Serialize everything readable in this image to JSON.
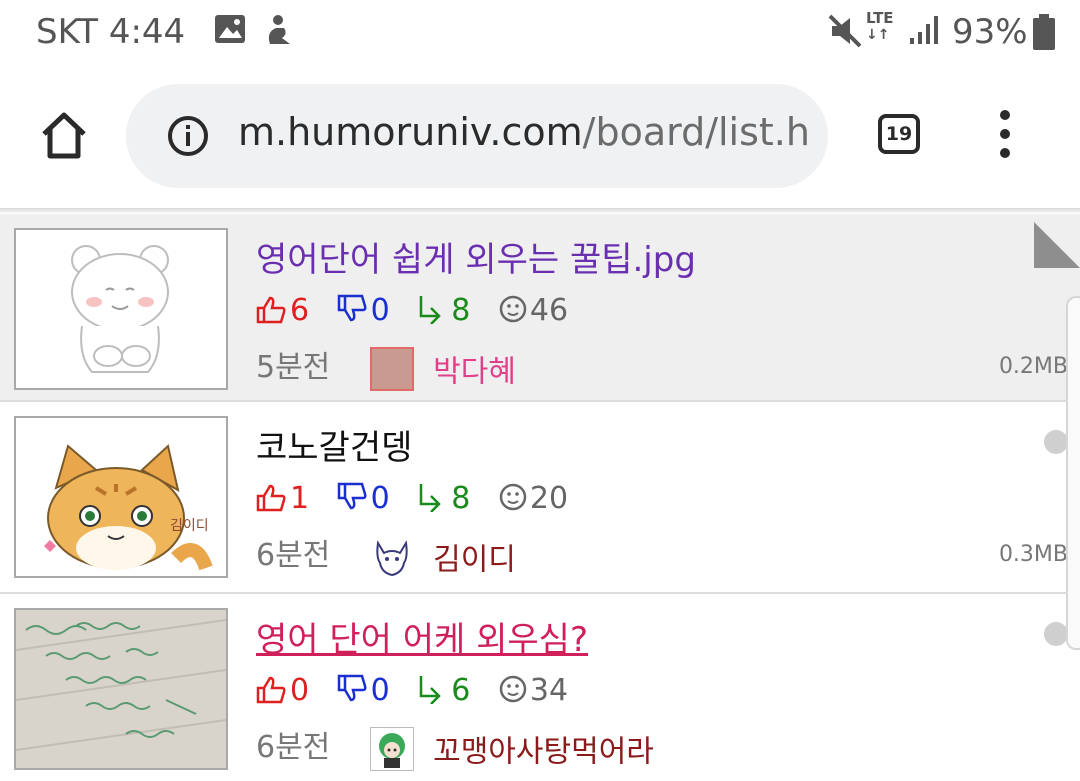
{
  "status_bar": {
    "carrier_time": "SKT 4:44",
    "network": "LTE",
    "battery": "93%",
    "icons": [
      "image-icon",
      "accessibility-icon",
      "mute-icon",
      "lte-icon",
      "signal-icon",
      "battery-icon"
    ]
  },
  "browser": {
    "url_domain": "m.humoruniv.com",
    "url_path": "/board/list.h",
    "tab_count": "19",
    "icons": [
      "home-icon",
      "info-icon",
      "tab-switcher-icon",
      "more-menu-icon"
    ]
  },
  "posts": [
    {
      "title": "영어단어 쉽게 외우는 꿀팁.jpg",
      "title_color": "#6a2fb0",
      "likes": "6",
      "dislikes": "0",
      "shares": "8",
      "comments": "46",
      "time": "5분전",
      "author": "박다혜",
      "author_color": "#e0408a",
      "size": "0.2MB"
    },
    {
      "title": "코노갈건뎅",
      "title_color": "#111111",
      "likes": "1",
      "dislikes": "0",
      "shares": "8",
      "comments": "20",
      "time": "6분전",
      "author": "김이디",
      "author_color": "#8b1a1a",
      "size": "0.3MB"
    },
    {
      "title": "영어 단어 어케 외우심?",
      "title_color": "#d0205a",
      "likes": "0",
      "dislikes": "0",
      "shares": "6",
      "comments": "34",
      "time": "6분전",
      "author": "꼬맹아사탕먹어라",
      "author_color": "#8b1a1a",
      "size": ""
    }
  ],
  "colors": {
    "like": "#e02020",
    "dislike": "#1a2fd0",
    "share": "#1a8a1a",
    "comment": "#666666"
  }
}
